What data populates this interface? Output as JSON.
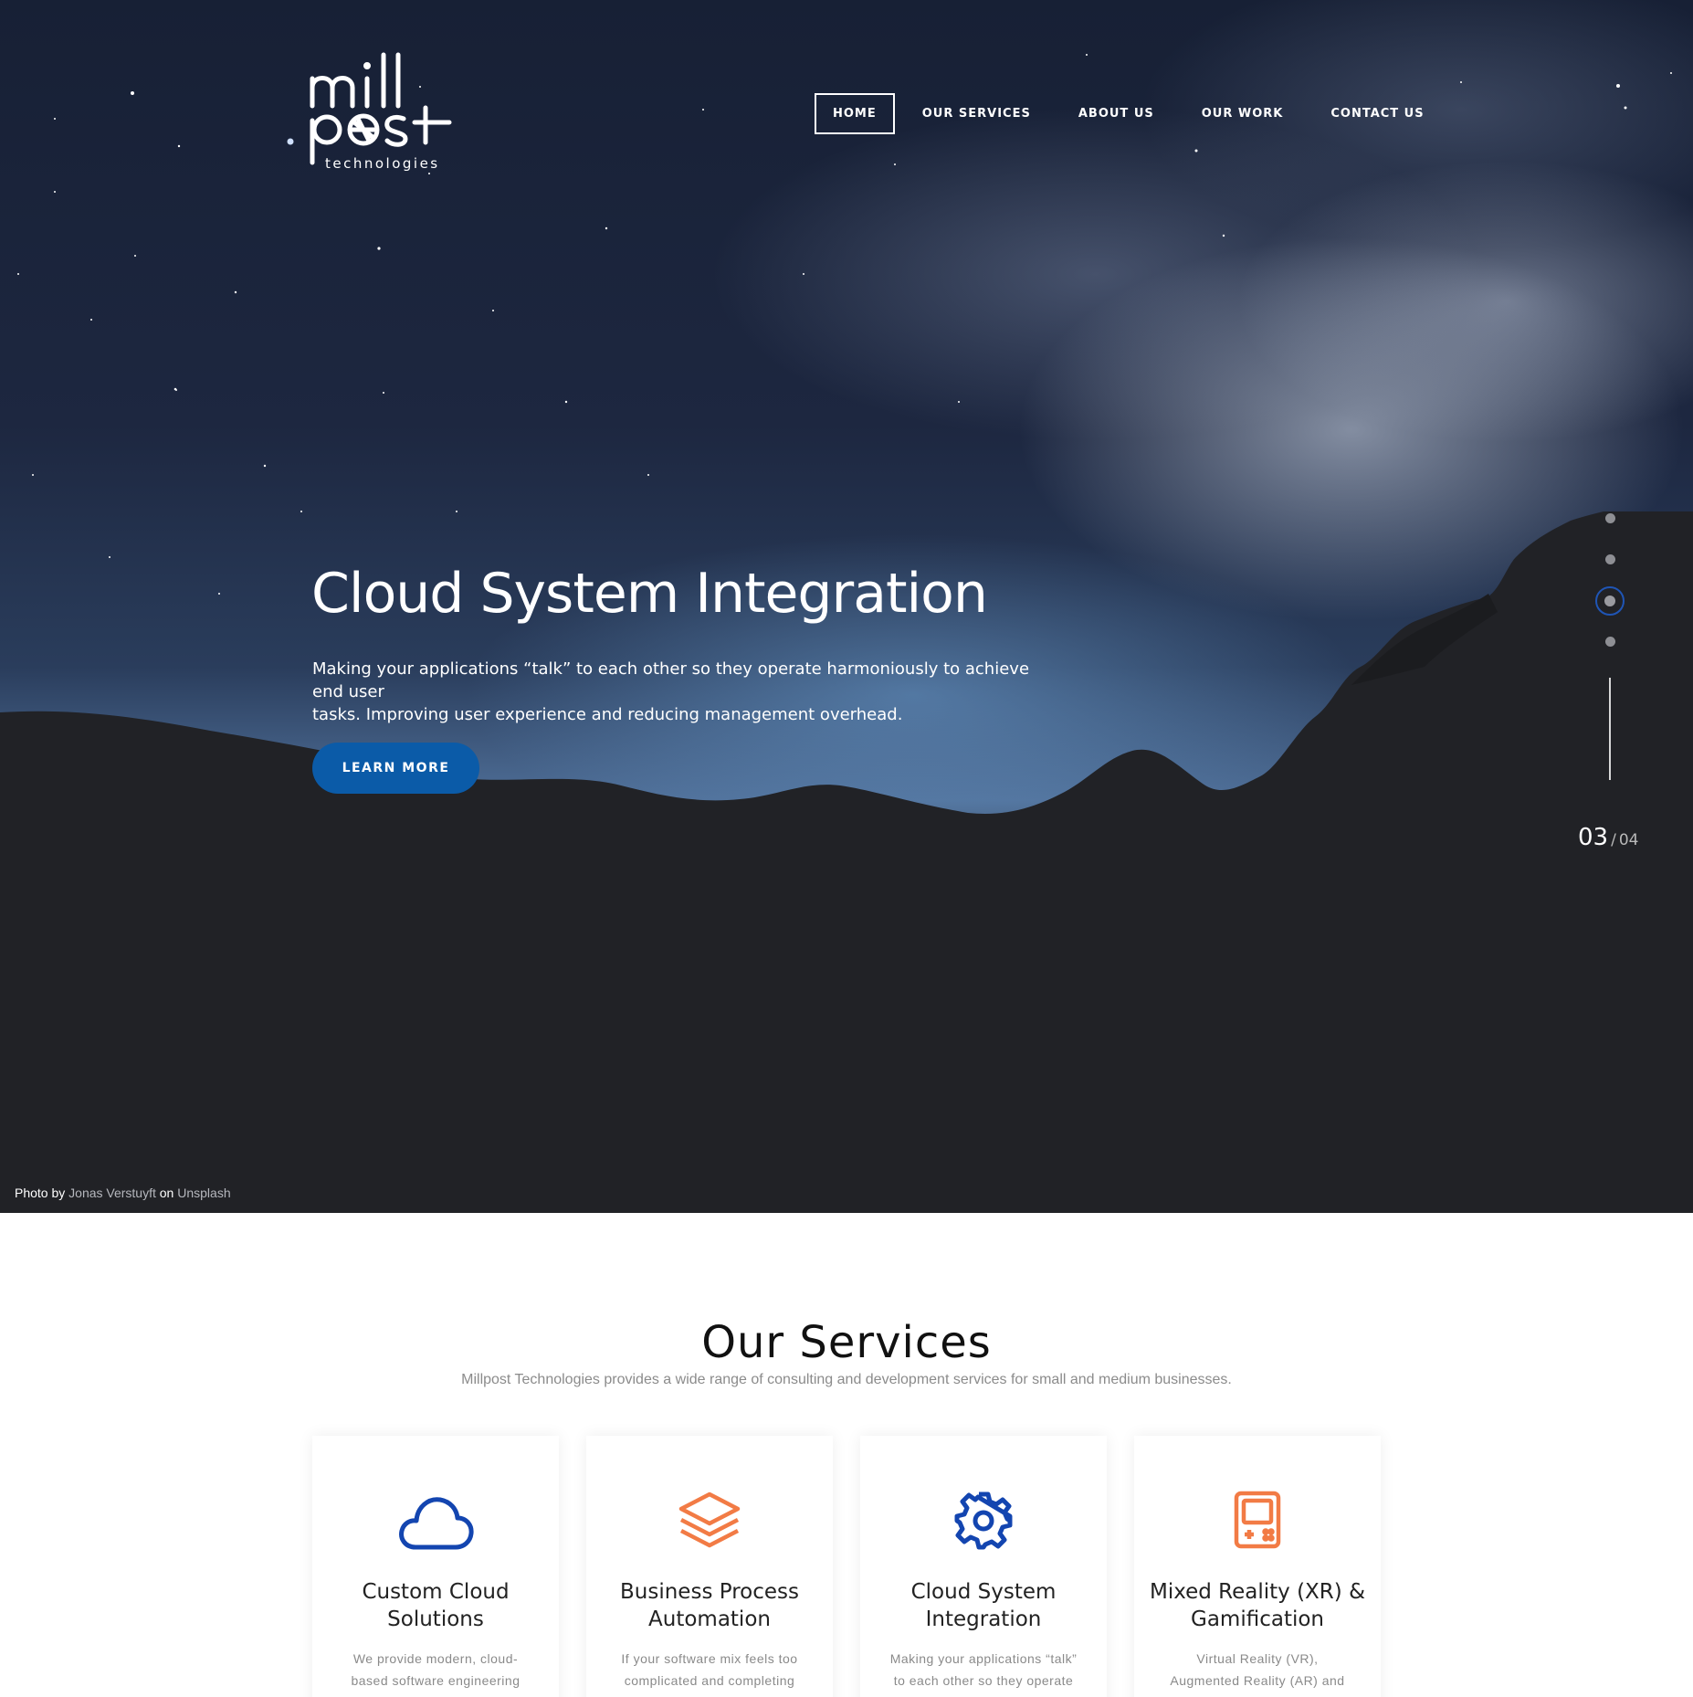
{
  "brand": {
    "logo_line1": "mill",
    "logo_line2": "post",
    "logo_line3": "technologies",
    "blue": "#0b5ba8",
    "orange": "#f27b45",
    "icon_blue": "#1345b0"
  },
  "nav": {
    "items": [
      "HOME",
      "OUR SERVICES",
      "ABOUT US",
      "OUR WORK",
      "CONTACT US"
    ],
    "active": "HOME"
  },
  "hero": {
    "title": "Cloud System Integration",
    "description_line1": "Making your applications “talk” to each other so they operate harmoniously to achieve end user",
    "description_line2": "tasks. Improving user experience and reducing management overhead.",
    "button_label": "LEARN MORE",
    "slide_current": "03",
    "slide_separator": "/",
    "slide_total": "04",
    "active_slide_index": 3,
    "credit_prefix": "Photo by",
    "credit_author": "Jonas Verstuyft",
    "credit_mid": "on",
    "credit_site": "Unsplash"
  },
  "services": {
    "title": "Our Services",
    "subtitle": "Millpost Technologies provides a wide range of consulting and development services for small and medium businesses.",
    "cards": [
      {
        "icon": "cloud-icon",
        "title": "Custom Cloud Solutions",
        "text": "We provide modern, cloud-based software engineering"
      },
      {
        "icon": "layers-icon",
        "title": "Business Process Automation",
        "text": "If your software mix feels too complicated and completing"
      },
      {
        "icon": "gear-icon",
        "title": "Cloud System Integration",
        "text": "Making your applications “talk” to each other so they operate"
      },
      {
        "icon": "handheld-game-icon",
        "title": "Mixed Reality (XR) & Gamification",
        "text": "Virtual Reality (VR), Augmented Reality (AR) and Gamification"
      }
    ]
  }
}
